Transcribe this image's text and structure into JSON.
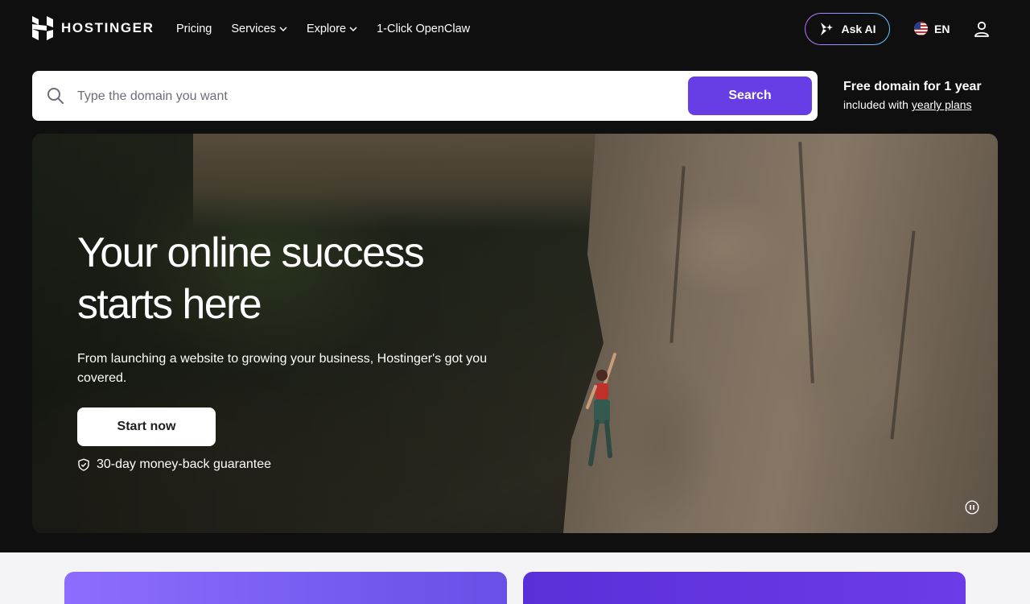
{
  "brand": {
    "name": "HOSTINGER"
  },
  "nav": {
    "items": [
      {
        "label": "Pricing",
        "dropdown": false
      },
      {
        "label": "Services",
        "dropdown": true
      },
      {
        "label": "Explore",
        "dropdown": true
      },
      {
        "label": "1-Click OpenClaw",
        "dropdown": false
      }
    ]
  },
  "header": {
    "ask_ai_label": "Ask AI",
    "language": "EN"
  },
  "search": {
    "placeholder": "Type the domain you want",
    "value": "",
    "button_label": "Search"
  },
  "promo": {
    "title": "Free domain for 1 year",
    "subtitle_prefix": "included with",
    "subtitle_link": "yearly plans"
  },
  "hero": {
    "title_line1": "Your online success",
    "title_line2": "starts here",
    "subtitle": "From launching a website to growing your business, Hostinger's got you covered.",
    "cta_label": "Start now",
    "guarantee": "30-day money-back guarantee"
  },
  "colors": {
    "accent": "#673de6",
    "background": "#0f0f10"
  }
}
